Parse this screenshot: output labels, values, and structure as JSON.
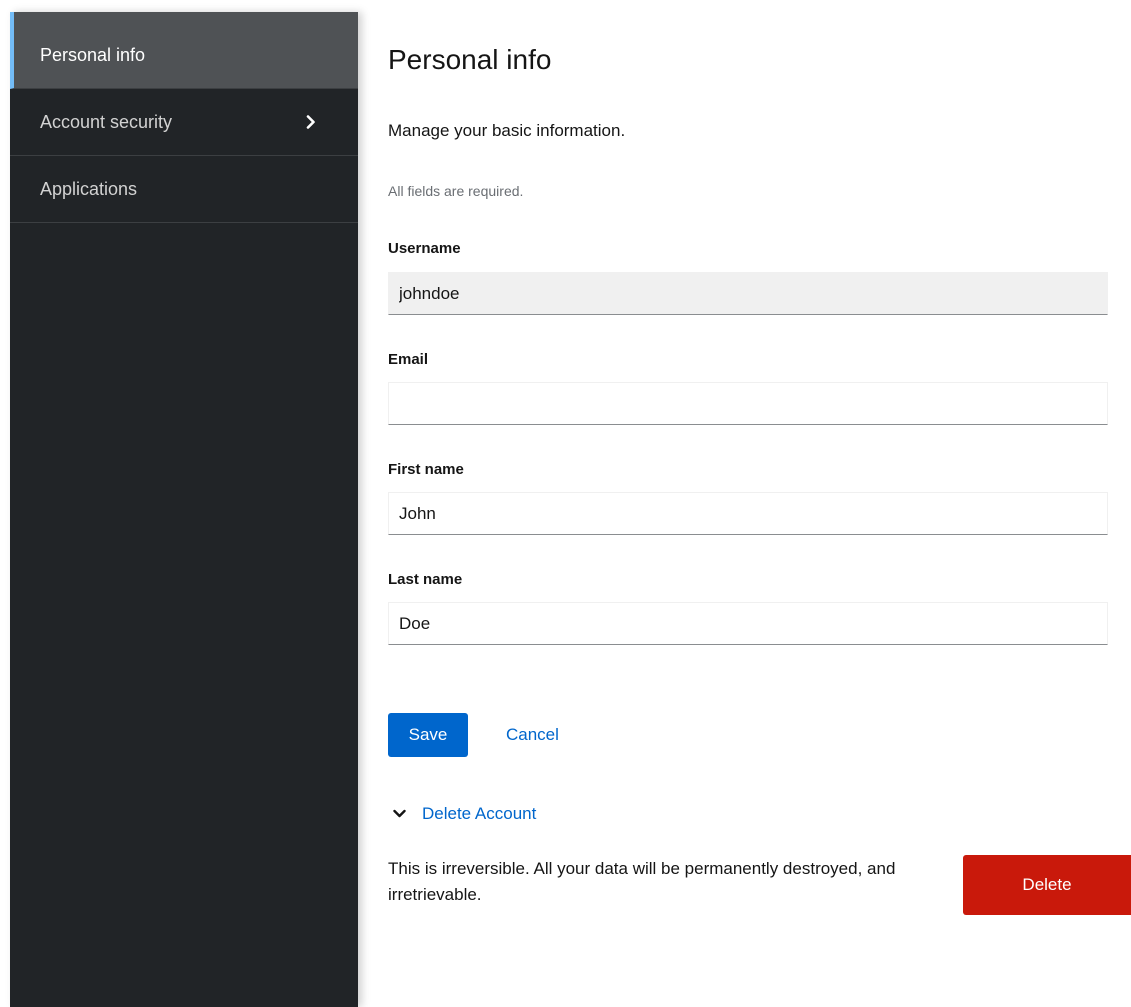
{
  "sidebar": {
    "items": [
      {
        "label": "Personal info",
        "active": true
      },
      {
        "label": "Account security",
        "active": false,
        "icon": "chevron-right-icon"
      },
      {
        "label": "Applications",
        "active": false
      }
    ]
  },
  "main": {
    "title": "Personal info",
    "description": "Manage your basic information.",
    "required_note": "All fields are required.",
    "fields": {
      "username": {
        "label": "Username",
        "value": "johndoe",
        "readonly": true
      },
      "email": {
        "label": "Email",
        "value": ""
      },
      "first_name": {
        "label": "First name",
        "value": "John"
      },
      "last_name": {
        "label": "Last name",
        "value": "Doe"
      }
    },
    "save_label": "Save",
    "cancel_label": "Cancel",
    "delete_section": {
      "toggle_label": "Delete Account",
      "toggle_icon": "chevron-down-icon",
      "warning": "This is irreversible. All your data will be permanently destroyed, and irretrievable.",
      "delete_label": "Delete"
    }
  },
  "colors": {
    "sidebar_bg": "#212427",
    "sidebar_active_bg": "#4f5255",
    "active_indicator": "#73bcf7",
    "primary": "#0066cc",
    "danger": "#c9190b"
  }
}
